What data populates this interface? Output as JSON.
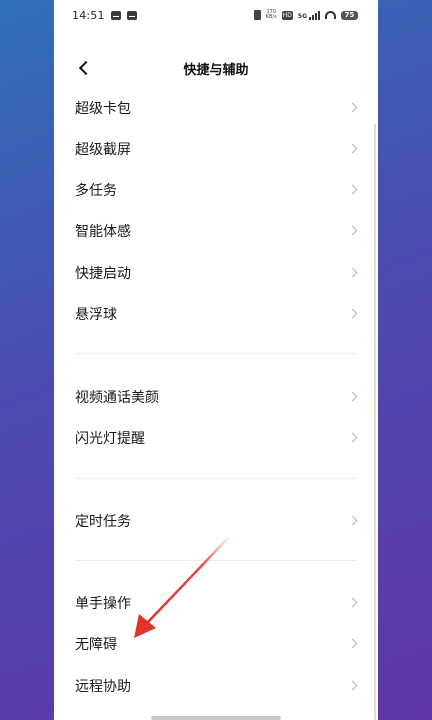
{
  "status_bar": {
    "time": "14:51",
    "net_speed": "170\nKB/s",
    "hd_label": "HD",
    "signal_label": "5G",
    "battery": "75"
  },
  "header": {
    "title": "快捷与辅助"
  },
  "items": [
    {
      "label": "超级卡包"
    },
    {
      "label": "超级截屏"
    },
    {
      "label": "多任务"
    },
    {
      "label": "智能体感"
    },
    {
      "label": "快捷启动"
    },
    {
      "label": "悬浮球"
    },
    {
      "label": "视频通话美颜"
    },
    {
      "label": "闪光灯提醒"
    },
    {
      "label": "定时任务"
    },
    {
      "label": "单手操作"
    },
    {
      "label": "无障碍"
    },
    {
      "label": "远程协助"
    }
  ],
  "annotation": {
    "color": "#e0322c",
    "icon": "red-arrow-pointing-to-accessibility"
  }
}
